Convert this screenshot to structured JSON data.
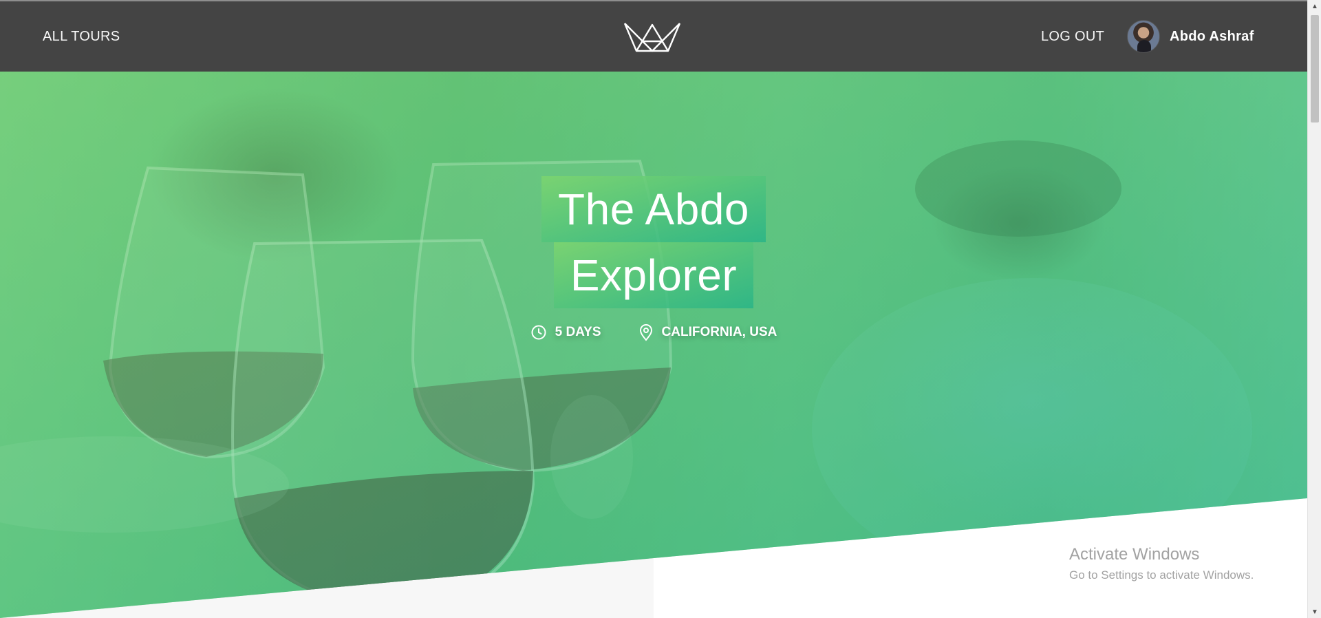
{
  "nav": {
    "all_tours": "All tours",
    "logout": "Log out",
    "user_name": "Abdo Ashraf",
    "logo_icon": "crown-logo-icon"
  },
  "tour": {
    "title_line_1": "The Abdo",
    "title_line_2": "Explorer",
    "duration": "5 days",
    "location": "California, USA"
  },
  "watermark": {
    "title": "Activate Windows",
    "subtitle": "Go to Settings to activate Windows."
  },
  "colors": {
    "header_bg": "#444444",
    "accent_light": "#7dd56f",
    "accent_dark": "#28b487"
  }
}
